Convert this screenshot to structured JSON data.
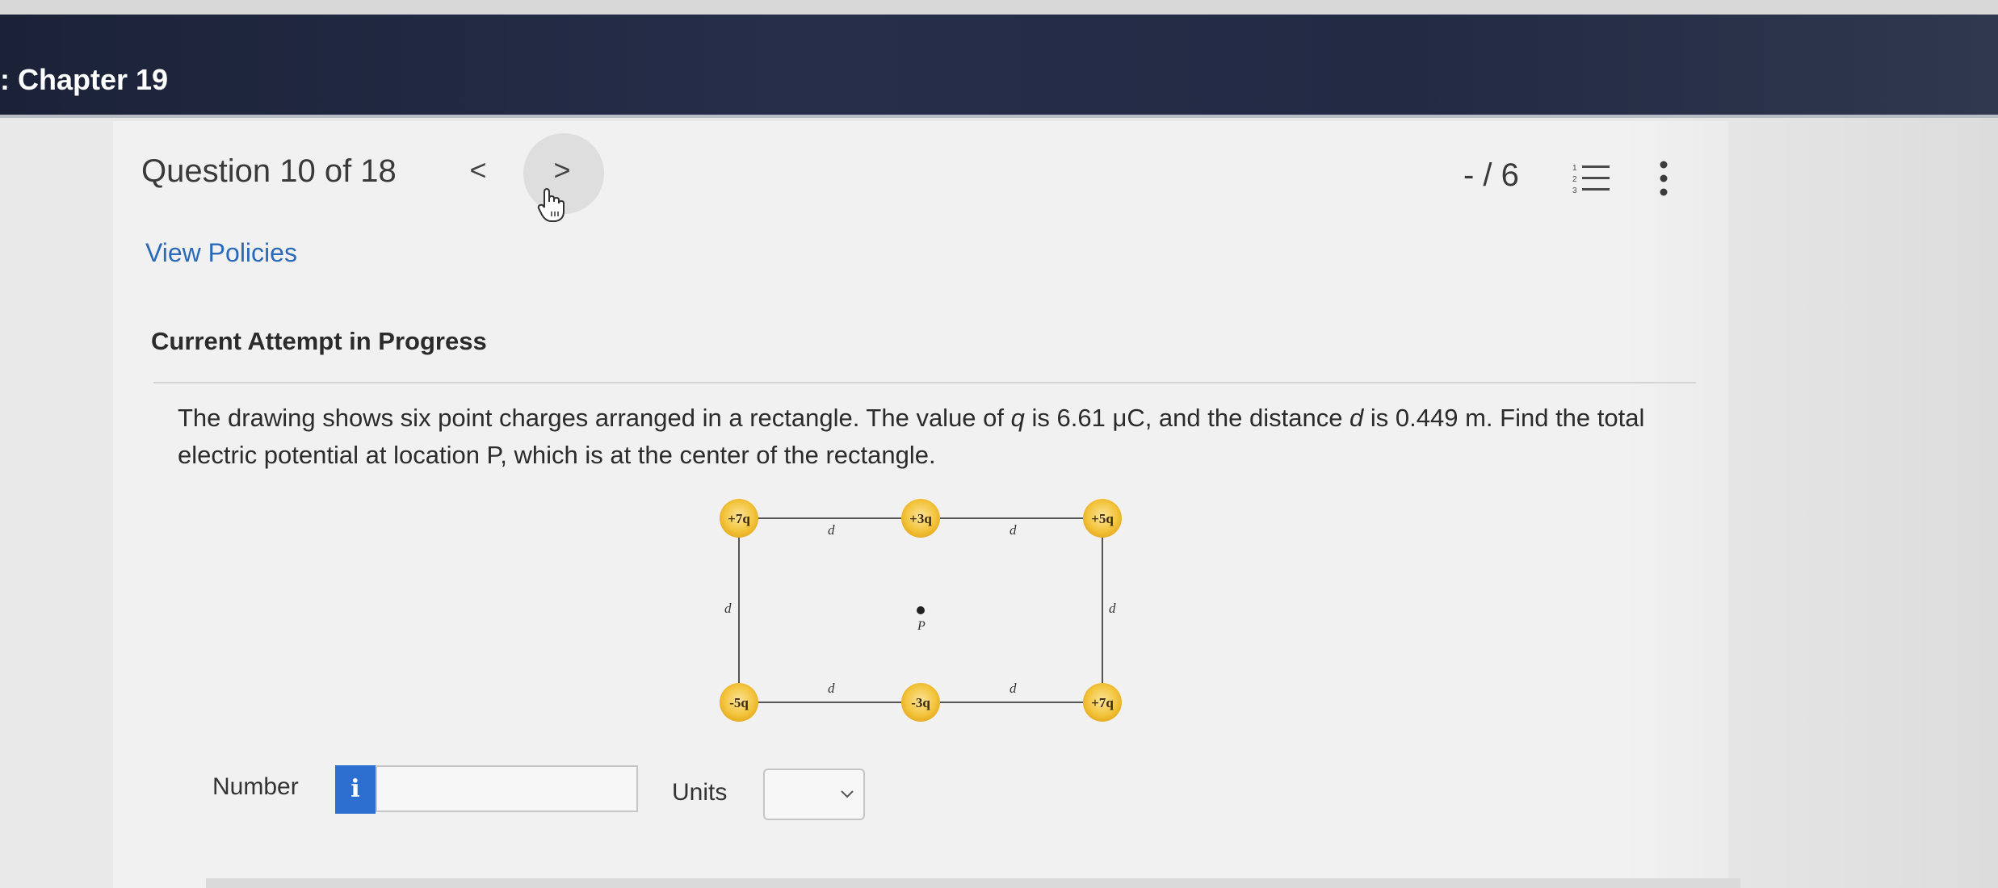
{
  "header": {
    "chapter_title": ": Chapter 19"
  },
  "question": {
    "title": "Question 10 of 18",
    "prev_label": "<",
    "next_label": ">",
    "score": "- / 6"
  },
  "links": {
    "view_policies": "View Policies"
  },
  "attempt": {
    "status": "Current Attempt in Progress"
  },
  "problem": {
    "text_1": "The drawing shows six point charges arranged in a rectangle. The value of ",
    "var_q": "q",
    "text_2": " is 6.61 μC, and the distance ",
    "var_d": "d",
    "text_3": " is 0.449 m. Find the total electric potential at location P, which is at the center of the rectangle."
  },
  "diagram": {
    "charges": {
      "top_left": "+7q",
      "top_middle": "+3q",
      "top_right": "+5q",
      "bottom_left": "-5q",
      "bottom_middle": "-3q",
      "bottom_right": "+7q"
    },
    "distance_label": "d",
    "point_label": "P",
    "colors": {
      "charge_fill": "#f3c43c",
      "charge_glow": "#f8de8a",
      "line": "#555555"
    }
  },
  "answer": {
    "number_label": "Number",
    "info_label": "i",
    "number_value": "",
    "units_label": "Units",
    "units_value": ""
  },
  "icons": [
    "chevron-left-icon",
    "chevron-right-icon",
    "hand-cursor-icon",
    "numbered-list-icon",
    "more-vertical-icon",
    "info-icon",
    "chevron-down-icon"
  ]
}
